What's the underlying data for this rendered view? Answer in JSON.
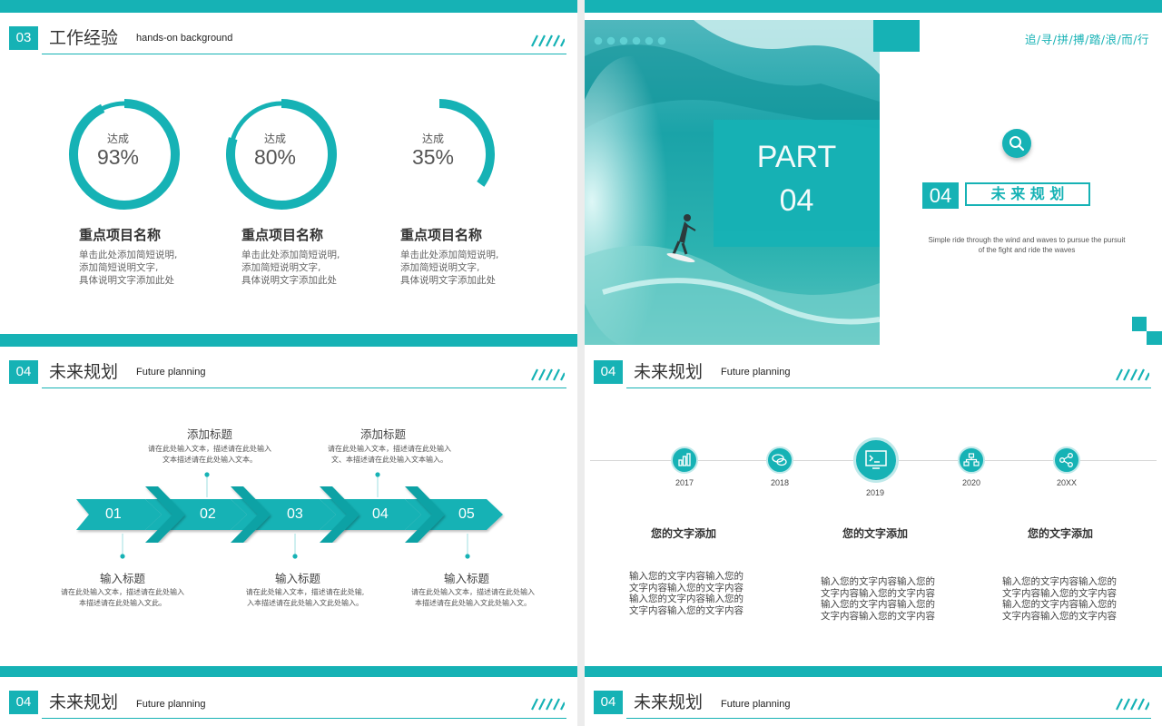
{
  "slide1": {
    "num": "03",
    "title": "工作经验",
    "subtitle": "hands-on background",
    "items": [
      {
        "label": "达成",
        "value": "93%",
        "percent": 93,
        "title": "重点项目名称",
        "desc": [
          "单击此处添加简短说明,",
          "添加简短说明文字,",
          "具体说明文字添加此处"
        ]
      },
      {
        "label": "达成",
        "value": "80%",
        "percent": 80,
        "title": "重点项目名称",
        "desc": [
          "单击此处添加简短说明,",
          "添加简短说明文字,",
          "具体说明文字添加此处"
        ]
      },
      {
        "label": "达成",
        "value": "35%",
        "percent": 35,
        "title": "重点项目名称",
        "desc": [
          "单击此处添加简短说明,",
          "添加简短说明文字,",
          "具体说明文字添加此处"
        ]
      }
    ]
  },
  "slide2": {
    "slogan": "追/寻/拼/搏/踏/浪/而/行",
    "part_line1": "PART",
    "part_line2": "04",
    "section_num": "04",
    "section_title": "未 来 规 划",
    "desc_line1": "Simple ride through the wind and waves to pursue the pursuit",
    "desc_line2": "of the fight and ride the waves"
  },
  "slide3": {
    "num": "04",
    "title": "未来规划",
    "subtitle": "Future planning",
    "steps": [
      "01",
      "02",
      "03",
      "04",
      "05"
    ],
    "top_items": [
      {
        "title": "添加标题",
        "desc1": "请在此处输入文本，描述请在此处输入",
        "desc2": "文本描述请在此处输入文本。"
      },
      {
        "title": "添加标题",
        "desc1": "请在此处输入文本，描述请在此处输入",
        "desc2": "文、本描述请在此处输入文本输入。"
      }
    ],
    "bottom_items": [
      {
        "title": "输入标题",
        "desc1": "请在此处输入文本，描述请在此处输入",
        "desc2": "本描述请在此处输入文此。"
      },
      {
        "title": "输入标题",
        "desc1": "请在此处输入文本，描述请在此处输,",
        "desc2": "入本描述请在此处输入文此处输入。"
      },
      {
        "title": "输入标题",
        "desc1": "请在此处输入文本，描述请在此处输入",
        "desc2": "本描述请在此处输入文此处输入文。"
      }
    ]
  },
  "slide4": {
    "num": "04",
    "title": "未来规划",
    "subtitle": "Future planning",
    "years": [
      "2017",
      "2018",
      "2019",
      "2020",
      "20XX"
    ],
    "columns": [
      {
        "title": "您的文字添加",
        "body": [
          "输入您的文字内容输入您的",
          "文字内容输入您的文字内容",
          "输入您的文字内容输入您的",
          "文字内容输入您的文字内容"
        ]
      },
      {
        "title": "您的文字添加",
        "body": [
          "输入您的文字内容输入您的",
          "文字内容输入您的文字内容",
          "输入您的文字内容输入您的",
          "文字内容输入您的文字内容"
        ]
      },
      {
        "title": "您的文字添加",
        "body": [
          "输入您的文字内容输入您的",
          "文字内容输入您的文字内容",
          "输入您的文字内容输入您的",
          "文字内容输入您的文字内容"
        ]
      }
    ]
  },
  "slide5": {
    "num": "04",
    "title": "未来规划",
    "subtitle": "Future planning"
  },
  "slide6": {
    "num": "04",
    "title": "未来规划",
    "subtitle": "Future planning"
  },
  "colors": {
    "accent": "#16b2b5",
    "text": "#333333"
  }
}
